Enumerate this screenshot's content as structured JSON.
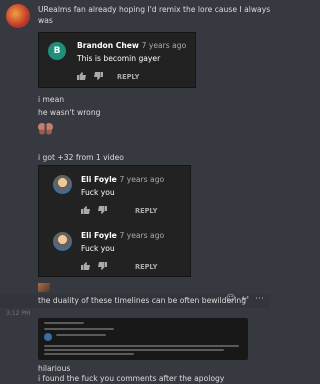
{
  "messages": {
    "m1_line1": "URealms fan already hoping I'd remix the lore cause I always",
    "m1_line2": "was",
    "m2": "i mean",
    "m3": "he wasn't wrong",
    "m4": "i got +32 from 1 video",
    "m5": "the duality of these timelines can be often bewildering",
    "m6": "hilarious",
    "m7": "i found the fuck you comments after the apology"
  },
  "embed1": {
    "avatar_letter": "B",
    "author": "Brandon Chew",
    "time": "7 years ago",
    "text": "This is becomin gayer",
    "reply": "REPLY",
    "avatar_color": "#1e8f7a"
  },
  "embed2": {
    "comments": [
      {
        "author": "Eli Foyle",
        "time": "7 years ago",
        "text": "Fuck you",
        "reply": "REPLY"
      },
      {
        "author": "Eli Foyle",
        "time": "7 years ago",
        "text": "Fuck you",
        "reply": "REPLY"
      }
    ]
  },
  "timestamp": "3:12 PM",
  "icons": [
    "add-reaction-icon",
    "reply-icon",
    "more-icon",
    "moth-emoji-icon",
    "thumbs-up-icon",
    "thumbs-down-icon"
  ]
}
